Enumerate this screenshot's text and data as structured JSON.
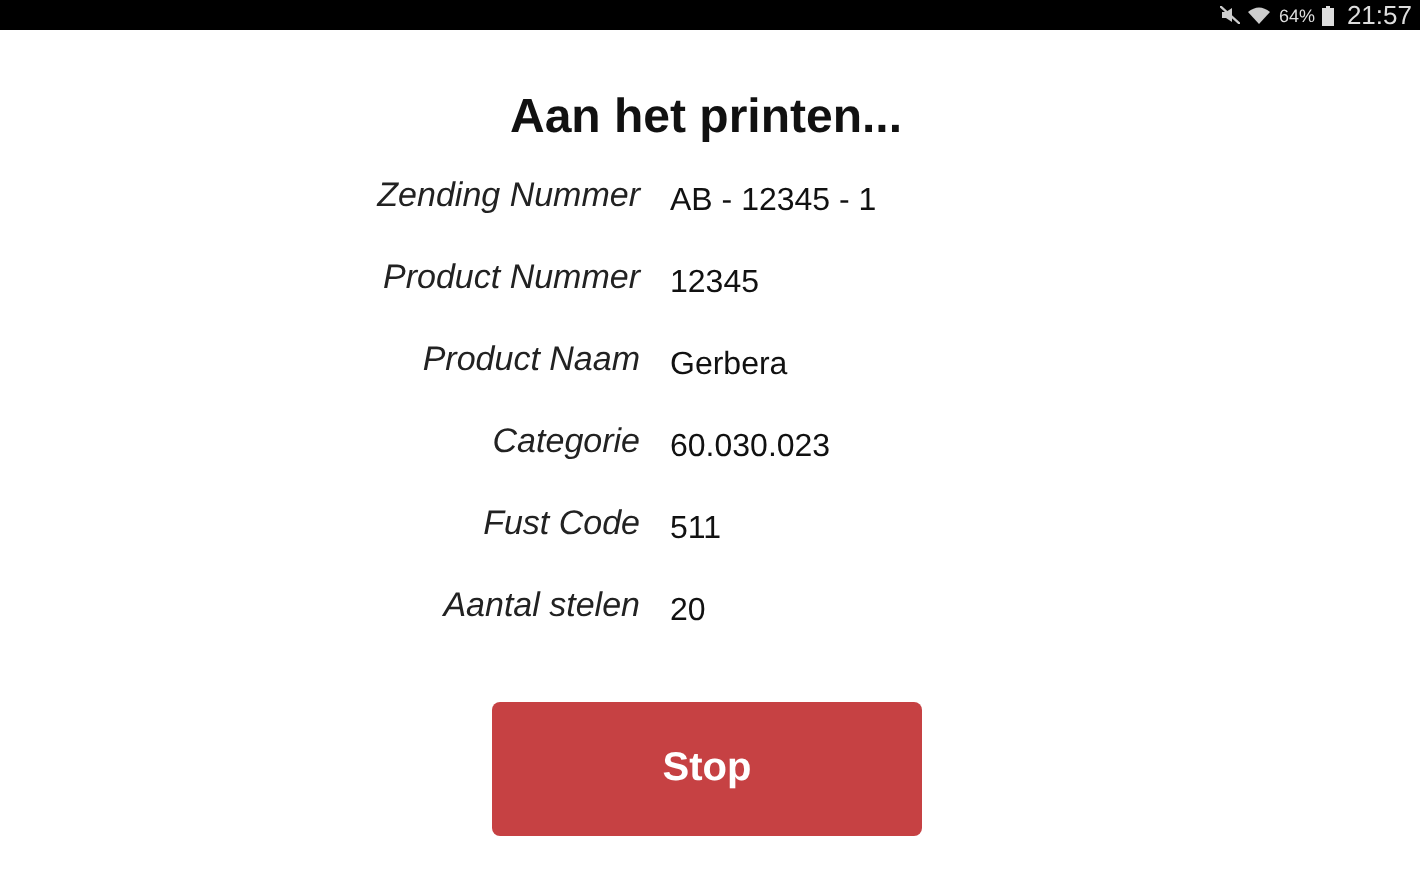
{
  "status_bar": {
    "battery": "64%",
    "time": "21:57"
  },
  "title": "Aan het printen...",
  "fields": [
    {
      "label": "Zending Nummer",
      "value": "AB - 12345 - 1"
    },
    {
      "label": "Product Nummer",
      "value": "12345"
    },
    {
      "label": "Product Naam",
      "value": "Gerbera"
    },
    {
      "label": "Categorie",
      "value": "60.030.023"
    },
    {
      "label": "Fust Code",
      "value": "511"
    },
    {
      "label": "Aantal stelen",
      "value": "20"
    }
  ],
  "button": "Stop"
}
